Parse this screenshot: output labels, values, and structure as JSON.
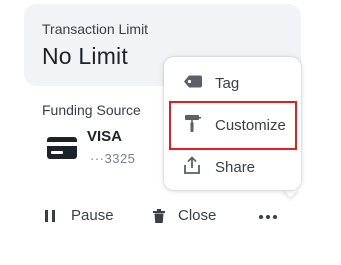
{
  "transaction_limit": {
    "label": "Transaction Limit",
    "value": "No Limit"
  },
  "funding_source": {
    "label": "Funding Source",
    "card_brand": "VISA",
    "card_number": "···3325",
    "icon": "credit-card-icon"
  },
  "actions": {
    "pause_label": "Pause",
    "close_label": "Close",
    "more_icon": "more-dots-icon"
  },
  "menu": {
    "items": [
      {
        "label": "Tag",
        "icon": "tag-icon"
      },
      {
        "label": "Customize",
        "icon": "paint-roller-icon",
        "highlighted": true
      },
      {
        "label": "Share",
        "icon": "share-icon"
      }
    ]
  },
  "colors": {
    "card_background": "#f1f3f6",
    "text_primary": "#1d2128",
    "text_secondary": "#3a3f47",
    "highlight": "#e02020"
  }
}
